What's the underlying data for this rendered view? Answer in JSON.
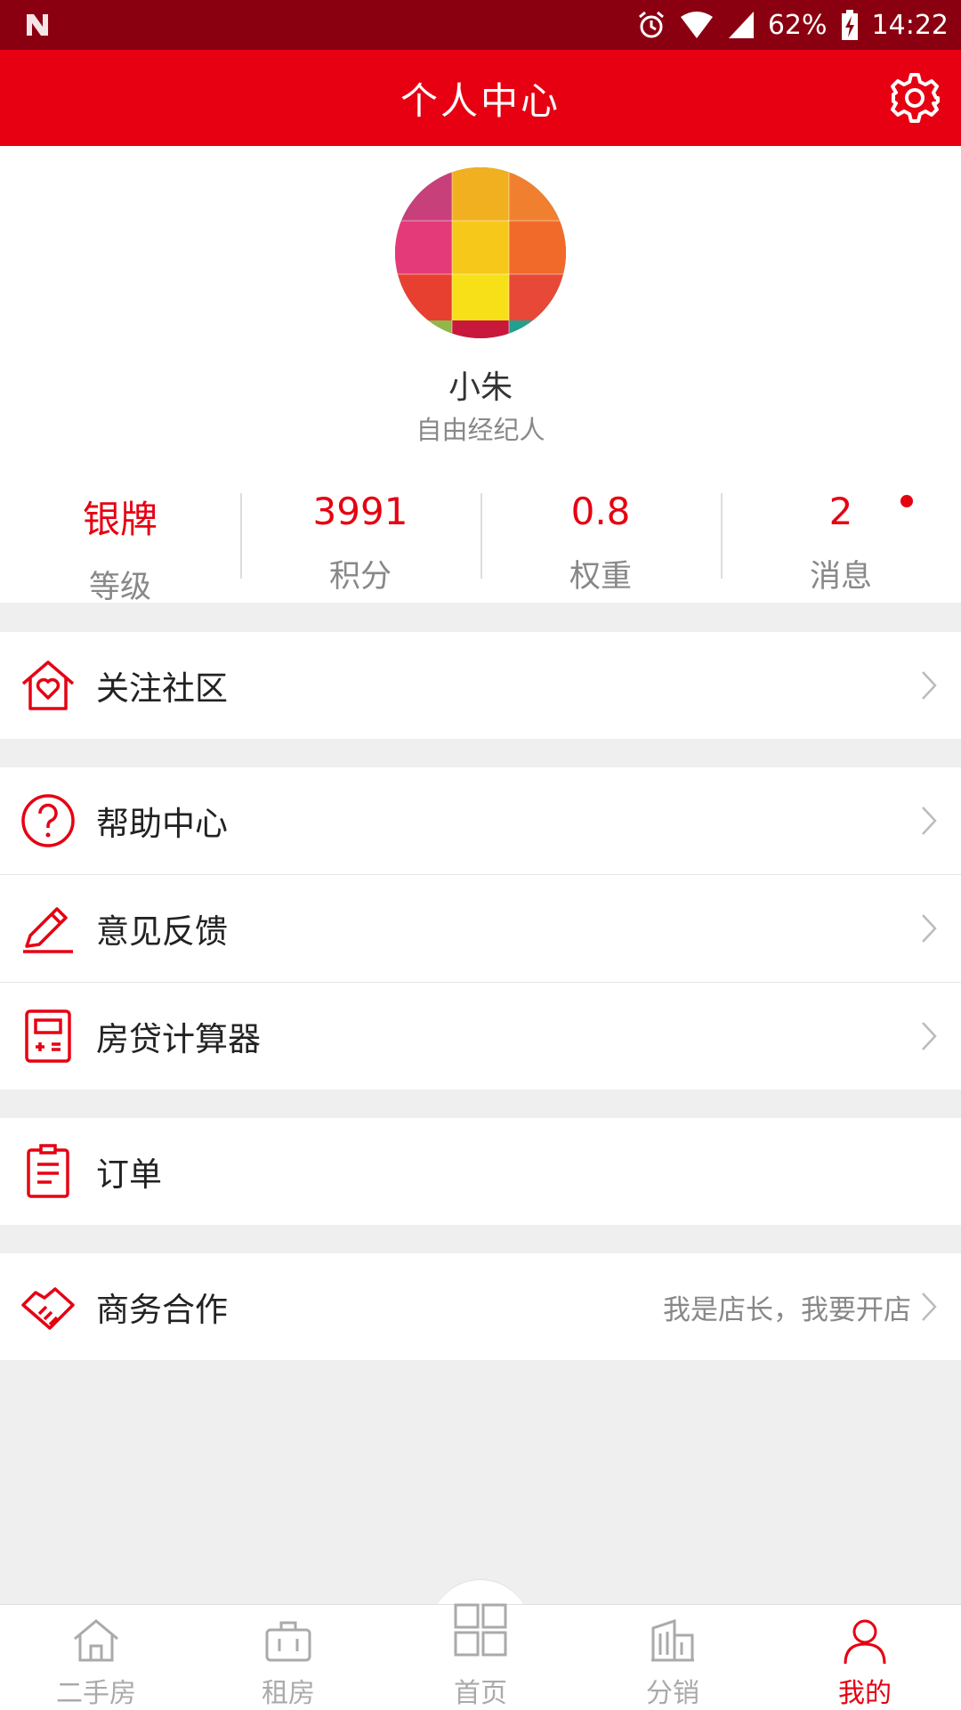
{
  "status_bar": {
    "battery": "62%",
    "time": "14:22"
  },
  "header": {
    "title": "个人中心"
  },
  "profile": {
    "name": "小朱",
    "role": "自由经纪人"
  },
  "stats": [
    {
      "value": "银牌",
      "label": "等级"
    },
    {
      "value": "3991",
      "label": "积分"
    },
    {
      "value": "0.8",
      "label": "权重"
    },
    {
      "value": "2",
      "label": "消息"
    }
  ],
  "menu": {
    "follow_community": "关注社区",
    "help_center": "帮助中心",
    "feedback": "意见反馈",
    "mortgage_calculator": "房贷计算器",
    "orders": "订单",
    "business": "商务合作",
    "business_extra": "我是店长，我要开店"
  },
  "tabs": [
    {
      "label": "二手房",
      "icon": "house-icon",
      "active": false
    },
    {
      "label": "租房",
      "icon": "briefcase-icon",
      "active": false
    },
    {
      "label": "首页",
      "icon": "grid-icon",
      "active": false
    },
    {
      "label": "分销",
      "icon": "buildings-icon",
      "active": false
    },
    {
      "label": "我的",
      "icon": "person-icon",
      "active": true
    }
  ],
  "colors": {
    "brand_red": "#e60012",
    "status_red": "#8a0011",
    "muted": "#aaaaaa"
  }
}
